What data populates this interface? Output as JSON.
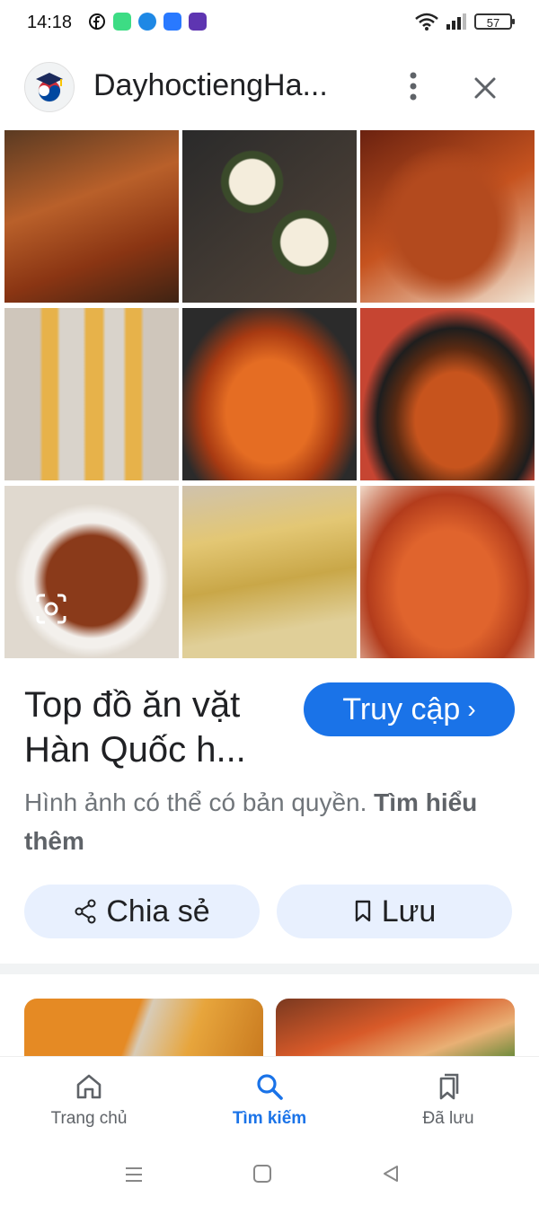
{
  "status_bar": {
    "time": "14:18",
    "battery": "57",
    "icons": [
      "facebook-icon",
      "app-green-icon",
      "messenger-icon",
      "novel-toon-icon",
      "game-icon",
      "wifi-icon",
      "signal-icon"
    ]
  },
  "header": {
    "site_title": "DayhoctiengHa...",
    "more_icon": "more-vert-icon",
    "close_icon": "close-icon"
  },
  "result": {
    "caption": "Top đồ ăn vặt Hàn Quốc h...",
    "visit_label": "Truy cập",
    "copyright_text": "Hình ảnh có thể có bản quyền.",
    "learn_more": "Tìm hiểu thêm",
    "share_label": "Chia sẻ",
    "save_label": "Lưu"
  },
  "bottom_nav": {
    "items": [
      {
        "label": "Trang chủ",
        "icon": "home-icon"
      },
      {
        "label": "Tìm kiếm",
        "icon": "search-icon"
      },
      {
        "label": "Đã lưu",
        "icon": "bookmarks-icon"
      }
    ],
    "active_index": 1
  },
  "system_nav": [
    "menu-icon",
    "home-square-icon",
    "back-triangle-icon"
  ],
  "colors": {
    "accent": "#1a73e8",
    "chip_bg": "#e8f0fe",
    "text_primary": "#202124",
    "text_secondary": "#70757a"
  }
}
